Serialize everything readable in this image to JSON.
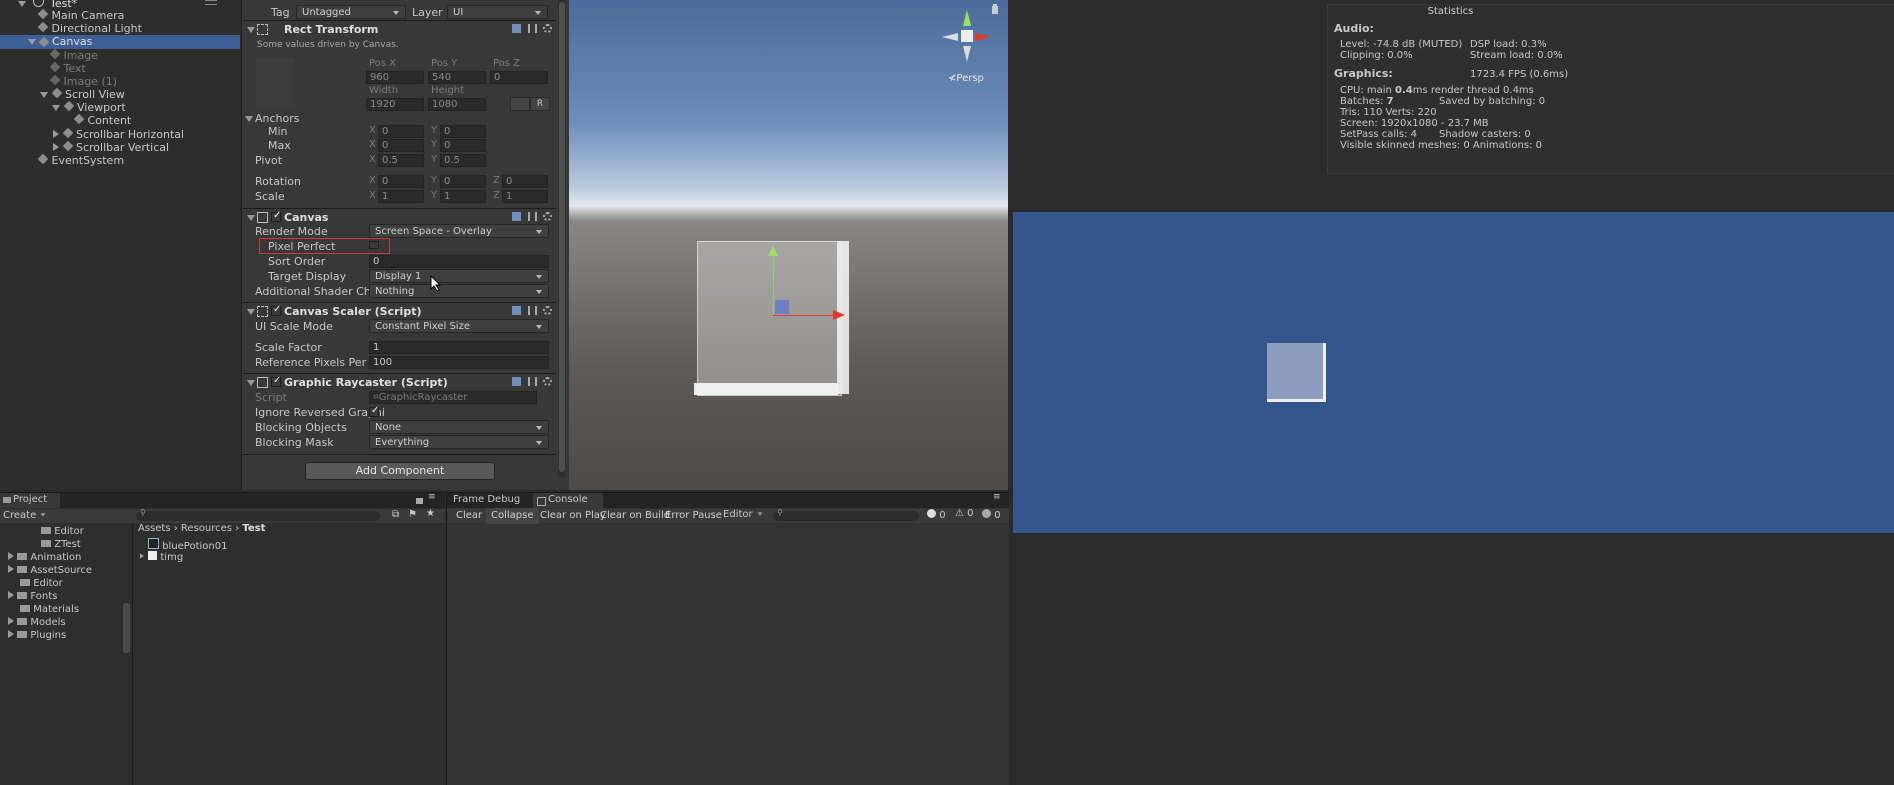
{
  "hierarchy": {
    "scene": "Test*",
    "items": [
      {
        "label": "Main Camera"
      },
      {
        "label": "Directional Light"
      },
      {
        "label": "Canvas"
      },
      {
        "label": "Image"
      },
      {
        "label": "Text"
      },
      {
        "label": "Image (1)"
      },
      {
        "label": "Scroll View"
      },
      {
        "label": "Viewport"
      },
      {
        "label": "Content"
      },
      {
        "label": "Scrollbar Horizontal"
      },
      {
        "label": "Scrollbar Vertical"
      },
      {
        "label": "EventSystem"
      }
    ]
  },
  "inspector": {
    "tag_label": "Tag",
    "tag_value": "Untagged",
    "layer_label": "Layer",
    "layer_value": "UI",
    "rect": {
      "title": "Rect Transform",
      "note": "Some values driven by Canvas.",
      "posx_label": "Pos X",
      "posy_label": "Pos Y",
      "posz_label": "Pos Z",
      "posx": "960",
      "posy": "540",
      "posz": "0",
      "width_label": "Width",
      "height_label": "Height",
      "width": "1920",
      "height": "1080",
      "r_button": "R",
      "anchors": "Anchors",
      "min": "Min",
      "max": "Max",
      "pivot": "Pivot",
      "rotation": "Rotation",
      "scale": "Scale",
      "x": "X",
      "y": "Y",
      "z": "Z",
      "min_x": "0",
      "min_y": "0",
      "max_x": "0",
      "max_y": "0",
      "pivot_x": "0.5",
      "pivot_y": "0.5",
      "rot_x": "0",
      "rot_y": "0",
      "rot_z": "0",
      "scale_x": "1",
      "scale_y": "1",
      "scale_z": "1"
    },
    "canvas": {
      "title": "Canvas",
      "render_mode_label": "Render Mode",
      "render_mode": "Screen Space - Overlay",
      "pixel_perfect": "Pixel Perfect",
      "sort_order_label": "Sort Order",
      "sort_order": "0",
      "target_display_label": "Target Display",
      "target_display": "Display 1",
      "shader_label": "Additional Shader Chann",
      "shader_value": "Nothing"
    },
    "scaler": {
      "title": "Canvas Scaler (Script)",
      "ui_scale_label": "UI Scale Mode",
      "ui_scale": "Constant Pixel Size",
      "scale_factor_label": "Scale Factor",
      "scale_factor": "1",
      "ref_label": "Reference Pixels Per Un",
      "ref_value": "100"
    },
    "raycaster": {
      "title": "Graphic Raycaster (Script)",
      "script_label": "Script",
      "script_value": "GraphicRaycaster",
      "ignore_label": "Ignore Reversed Graphi",
      "blocking_objects_label": "Blocking Objects",
      "blocking_objects": "None",
      "blocking_mask_label": "Blocking Mask",
      "blocking_mask": "Everything"
    },
    "add_component": "Add Component"
  },
  "scene_view": {
    "persp": "Persp"
  },
  "stats": {
    "title": "Statistics",
    "audio": "Audio:",
    "level": "Level: -74.8 dB (MUTED)",
    "dsp": "DSP load: 0.3%",
    "clipping": "Clipping: 0.0%",
    "stream": "Stream load: 0.0%",
    "graphics": "Graphics:",
    "fps": "1723.4 FPS (0.6ms)",
    "cpu_a": "CPU: main ",
    "cpu_b": "0.4",
    "cpu_c": "ms  render thread 0.4ms",
    "batches_a": "Batches: ",
    "batches_b": "7",
    "saved": "Saved by batching: 0",
    "tris": "Tris: 110  Verts: 220",
    "screen": "Screen: 1920x1080 - 23.7 MB",
    "setpass": "SetPass calls: 4",
    "shadow": "Shadow casters: 0",
    "skinned": "Visible skinned meshes: 0  Animations: 0"
  },
  "project": {
    "tab": "Project",
    "create": "Create",
    "tree": [
      "Editor",
      "ZTest",
      "Animation",
      "AssetSource",
      "Editor",
      "Fonts",
      "Materials",
      "Models",
      "Plugins"
    ],
    "breadcrumb": [
      "Assets",
      "Resources",
      "Test"
    ],
    "assets": [
      "bluePotion01",
      "timg"
    ]
  },
  "console": {
    "frame_debug": "Frame Debug",
    "tab": "Console",
    "clear": "Clear",
    "collapse": "Collapse",
    "clear_on_play": "Clear on Play",
    "clear_on_build": "Clear on Build",
    "error_pause": "Error Pause",
    "editor": "Editor",
    "count_info": "0",
    "count_warn": "0",
    "count_err": "0"
  }
}
